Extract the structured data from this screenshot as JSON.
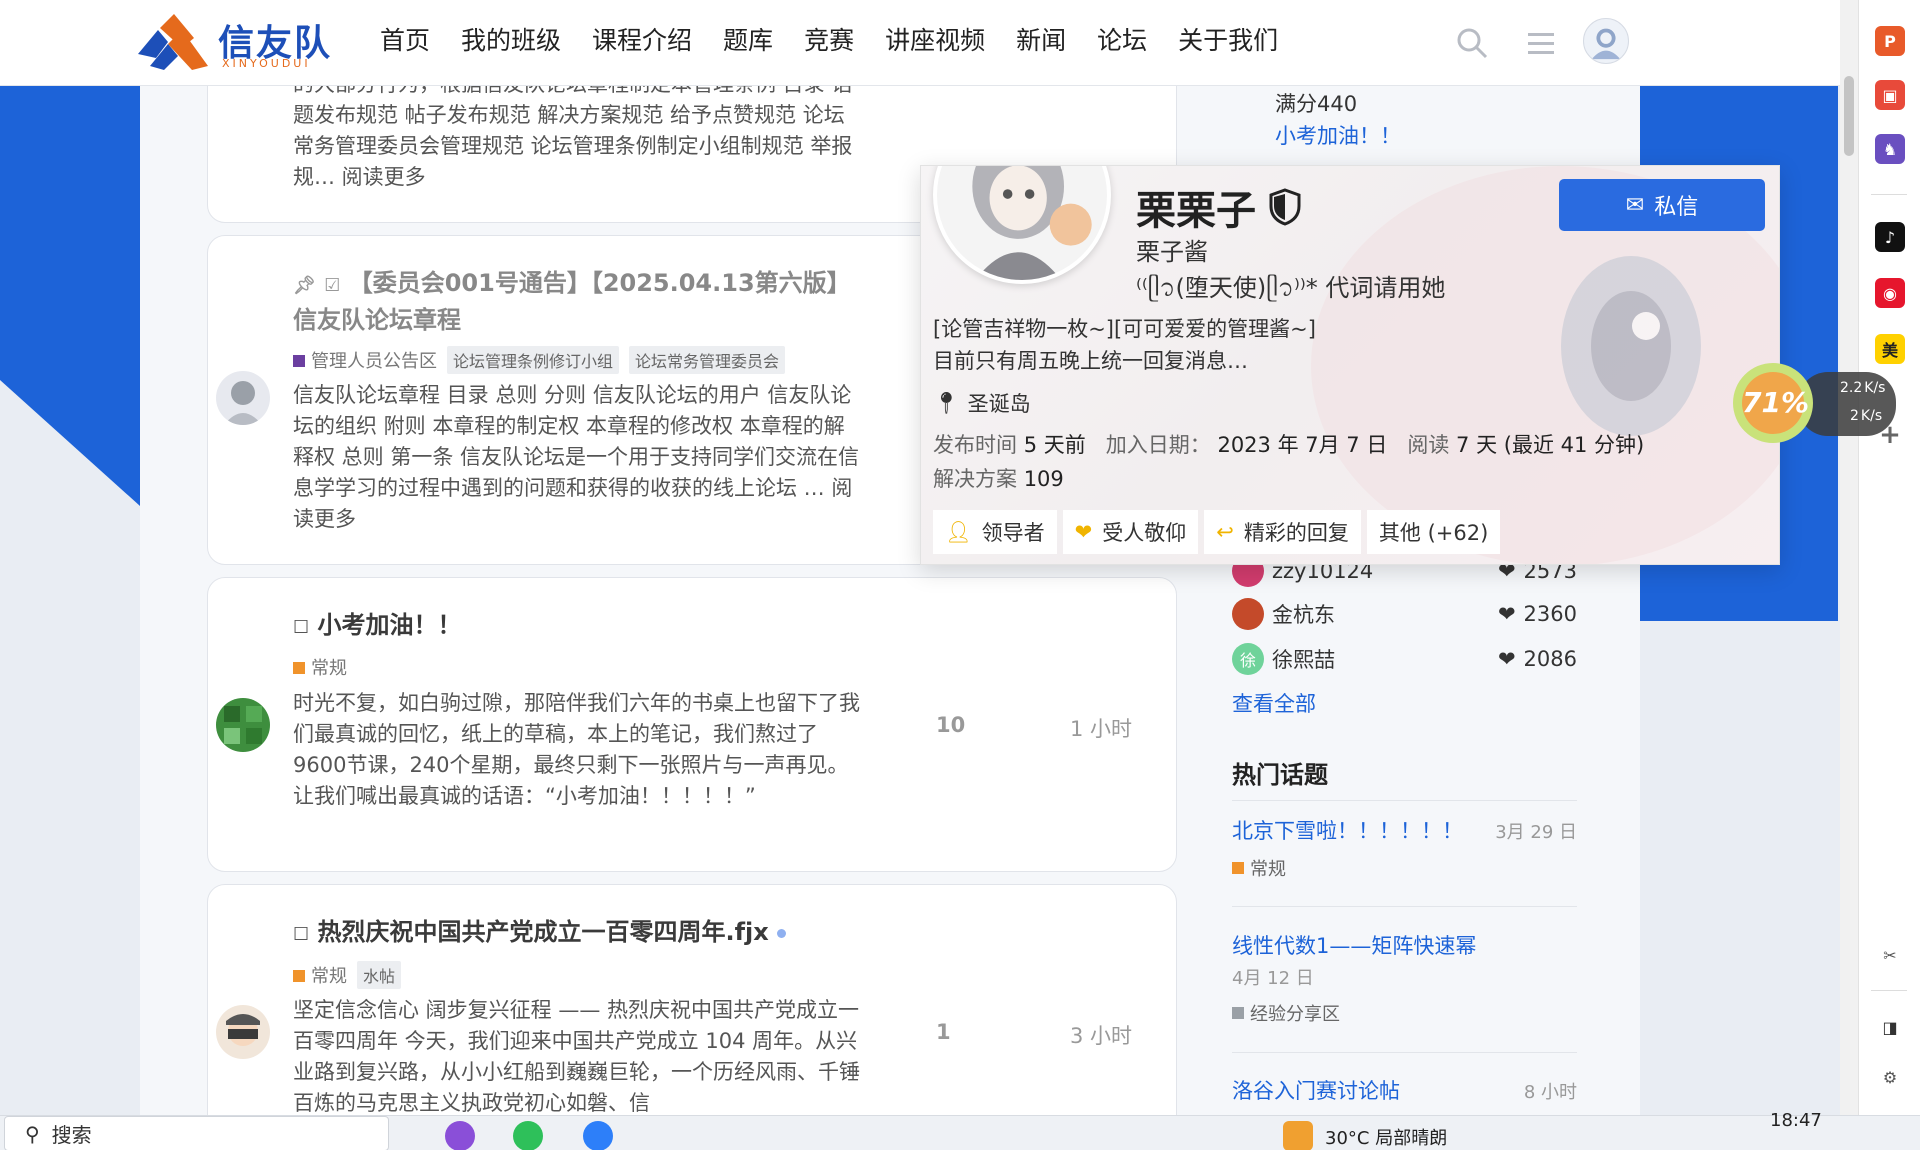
{
  "brand": {
    "name": "信友队",
    "sub": "XINYOUDUI"
  },
  "nav": [
    "首页",
    "我的班级",
    "课程介绍",
    "题库",
    "竞赛",
    "讲座视频",
    "新闻",
    "论坛",
    "关于我们"
  ],
  "topics": [
    {
      "excerpt": "的大部分行为，根据信友队论坛章程制定本管理条例 目录 话题发布规范 帖子发布规范 解决方案规范 给予点赞规范 论坛常务管理委员会管理规范 论坛管理条例制定小组制规范 举报规… 阅读更多"
    },
    {
      "title": "【委员会001号通告】【2025.04.13第六版】信友队论坛章程",
      "category": "管理人员公告区",
      "tags": [
        "论坛管理条例修订小组",
        "论坛常务管理委员会"
      ],
      "excerpt": "信友队论坛章程 目录 总则 分则 信友队论坛的用户 信友队论坛的组织 附则 本章程的制定权 本章程的修改权 本章程的解释权 总则 第一条 信友队论坛是一个用于支持同学们交流在信息学学习的过程中遇到的问题和获得的收获的线上论坛 … 阅读更多"
    },
    {
      "title": "小考加油！！",
      "category": "常规",
      "excerpt": "时光不复，如白驹过隙，那陪伴我们六年的书桌上也留下了我们最真诚的回忆，纸上的草稿，本上的笔记，我们熬过了9600节课，240个星期，最终只剩下一张照片与一声再见。让我们喊出最真诚的话语：“小考加油！！！！！”",
      "replies": "10",
      "time": "1 小时"
    },
    {
      "title": "热烈庆祝中国共产党成立一百零四周年.fjx",
      "category": "常规",
      "tags": [
        "水帖"
      ],
      "excerpt": "坚定信念信心 阔步复兴征程 —— 热烈庆祝中国共产党成立一百零四周年 今天，我们迎来中国共产党成立 104 周年。从兴业路到复兴路，从小小红船到巍巍巨轮，一个历经风雨、千锤百炼的马克思主义执政党初心如磐、信",
      "replies": "1",
      "time": "3 小时"
    }
  ],
  "sidebar": {
    "top_text": "满分440",
    "top_link": "小考加油！！",
    "users": [
      {
        "name": "zzy10124",
        "likes": "2573"
      },
      {
        "name": "金杭东",
        "likes": "2360"
      },
      {
        "name": "徐熙喆",
        "likes": "2086",
        "initial": "徐"
      }
    ],
    "view_all": "查看全部",
    "hot_heading": "热门话题",
    "hot": [
      {
        "title": "北京下雪啦！！！！！！",
        "date": "3月 29 日",
        "category": "常规"
      },
      {
        "title": "线性代数1——矩阵快速幂",
        "date": "4月 12 日",
        "category": "经验分享区"
      },
      {
        "title": "洛谷入门赛讨论帖",
        "date": "8 小时"
      }
    ]
  },
  "user_card": {
    "name": "栗栗子",
    "username": "栗子酱",
    "status": "⁽⁽ᥫ᭡(堕天使)ᥫ᭡⁾⁾* 代词请用她",
    "bio_line1": "[论管吉祥物一枚~][可可爱爱的管理酱~]",
    "bio_line2": "目前只有周五晚上统一回复消息…",
    "location": "圣诞岛",
    "posted_label": "发布时间",
    "posted_value": "5 天前",
    "joined_label": "加入日期：",
    "joined_value": "2023 年 7月 7 日",
    "read_label": "阅读",
    "read_value": "7 天 (最近 41 分钟)",
    "solutions_label": "解决方案",
    "solutions_value": "109",
    "message_button": "私信",
    "badges": [
      "领导者",
      "受人敬仰",
      "精彩的回复",
      "其他 (+62)"
    ]
  },
  "net_widget": {
    "percent": "71%",
    "up": "2.2",
    "down": "2",
    "unit": "K/s"
  },
  "taskbar": {
    "search": "搜索",
    "weather": "30°C  局部晴朗",
    "time": "18:47"
  },
  "colors": {
    "accent": "#1d63d8",
    "brand_orange": "#e56a1c",
    "admin_cat": "#6b3fa0",
    "normal_cat": "#f0932b",
    "share_cat": "#9aa0a6"
  }
}
